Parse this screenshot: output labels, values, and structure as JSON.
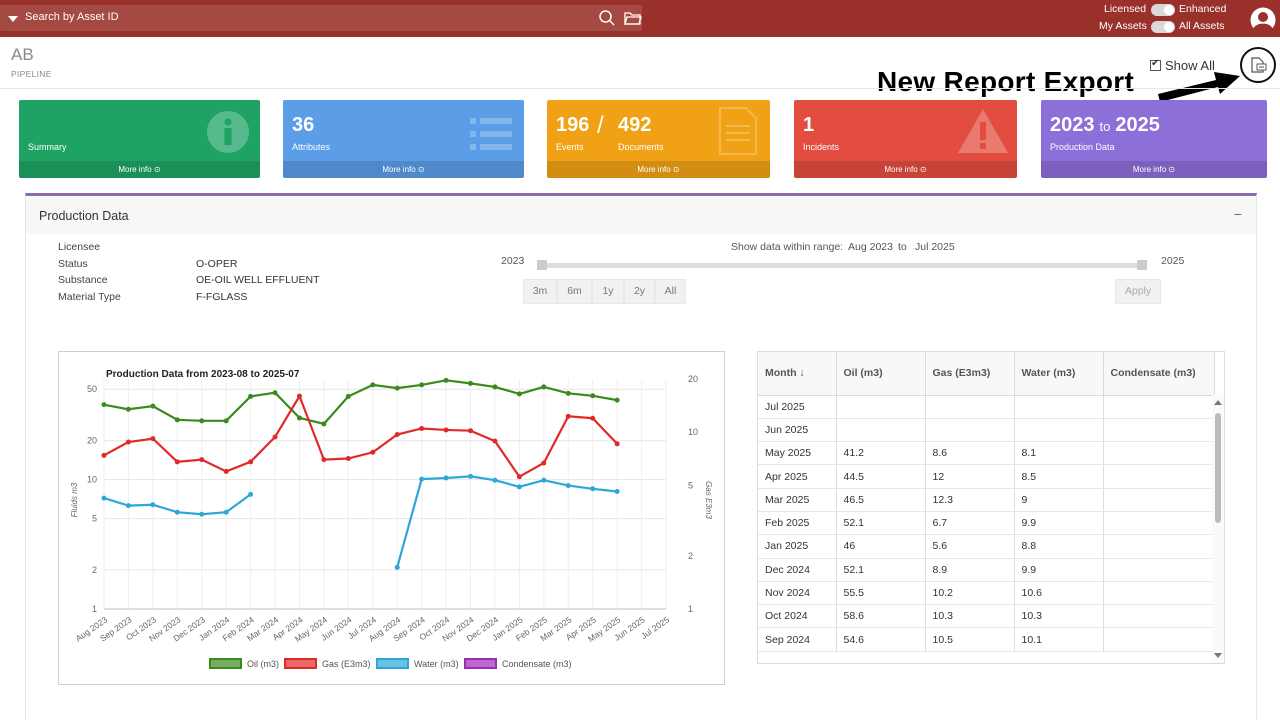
{
  "topbar": {
    "search_label": "Search by Asset ID",
    "licensed_label": "Licensed",
    "enhanced_label": "Enhanced",
    "my_assets_label": "My Assets",
    "all_assets_label": "All Assets"
  },
  "asset": {
    "id": "AB",
    "type": "PIPELINE"
  },
  "show_all_label": "Show All",
  "annotation": "New Report Export",
  "boxes": [
    {
      "number": "",
      "label": "Summary",
      "more": "More info",
      "color": "#1fa365",
      "icon": "info-icon"
    },
    {
      "number": "36",
      "label": "Attributes",
      "more": "More info",
      "color": "#5b9de6",
      "icon": "list-icon"
    },
    {
      "number": "196",
      "number2": "492",
      "label": "Events",
      "label2": "Documents",
      "more": "More info",
      "color": "#f1a116",
      "icon": "document-icon"
    },
    {
      "number": "1",
      "label": "Incidents",
      "more": "More info",
      "color": "#e24d3f",
      "icon": "warning-icon"
    },
    {
      "number": "2023",
      "to": "to",
      "number2": "2025",
      "label": "Production Data",
      "more": "More info",
      "color": "#8c6fd8",
      "icon": ""
    }
  ],
  "panel": {
    "title": "Production Data",
    "meta": [
      {
        "label": "Licensee",
        "value": ""
      },
      {
        "label": "Status",
        "value": "O-OPER"
      },
      {
        "label": "Substance",
        "value": "OE-OIL WELL EFFLUENT"
      },
      {
        "label": "Material Type",
        "value": "F-FGLASS"
      }
    ],
    "range_label": "Show data within range:",
    "range_from": "Aug 2023",
    "range_to_word": "to",
    "range_to": "Jul 2025",
    "year_start": "2023",
    "year_end": "2025",
    "buttons": [
      "3m",
      "6m",
      "1y",
      "2y",
      "All"
    ],
    "apply_label": "Apply"
  },
  "chart_data": {
    "type": "line",
    "title": "Production Data from 2023-08 to 2025-07",
    "ylabel": "Fluids m3",
    "y2label": "Gas E3m3",
    "y_scale": "log",
    "ylim": [
      1,
      60
    ],
    "y2lim": [
      1,
      20
    ],
    "yticks": [
      "1",
      "2",
      "5",
      "10",
      "20",
      "50"
    ],
    "y2ticks": [
      "1",
      "2",
      "5",
      "10",
      "20"
    ],
    "categories": [
      "Aug 2023",
      "Sep 2023",
      "Oct 2023",
      "Nov 2023",
      "Dec 2023",
      "Jan 2024",
      "Feb 2024",
      "Mar 2024",
      "Apr 2024",
      "May 2024",
      "Jun 2024",
      "Jul 2024",
      "Aug 2024",
      "Sep 2024",
      "Oct 2024",
      "Nov 2024",
      "Dec 2024",
      "Jan 2025",
      "Feb 2025",
      "Mar 2025",
      "Apr 2025",
      "May 2025",
      "Jun 2025",
      "Jul 2025"
    ],
    "series": [
      {
        "name": "Oil (m3)",
        "axis": "left",
        "color": "#3a8a1e",
        "values": [
          38,
          35,
          37,
          29,
          28.5,
          28.5,
          44,
          47,
          30,
          27,
          44,
          54,
          51,
          54,
          58.6,
          55.5,
          52.1,
          46,
          52.1,
          46.5,
          44.5,
          41.2,
          null,
          null
        ]
      },
      {
        "name": "Gas (E3m3)",
        "axis": "right",
        "color": "#e02a2a",
        "values": [
          7.4,
          8.8,
          9.2,
          6.8,
          7.0,
          6.0,
          6.8,
          9.4,
          16,
          7.0,
          7.1,
          7.7,
          9.7,
          10.5,
          10.3,
          10.2,
          8.9,
          5.6,
          6.7,
          12.3,
          12,
          8.6,
          null,
          null
        ]
      },
      {
        "name": "Water (m3)",
        "axis": "left",
        "color": "#2ca7d8",
        "values": [
          7.2,
          6.3,
          6.4,
          5.6,
          5.4,
          5.6,
          7.7,
          null,
          null,
          null,
          null,
          null,
          2.1,
          10.1,
          10.3,
          10.6,
          9.9,
          8.8,
          9.9,
          9,
          8.5,
          8.1,
          null,
          null
        ]
      },
      {
        "name": "Condensate (m3)",
        "axis": "left",
        "color": "#9c2bb5",
        "values": []
      }
    ]
  },
  "table": {
    "headers": [
      "Month",
      "Oil (m3)",
      "Gas (E3m3)",
      "Water (m3)",
      "Condensate (m3)"
    ],
    "rows": [
      [
        "Jul 2025",
        "",
        "",
        "",
        ""
      ],
      [
        "Jun 2025",
        "",
        "",
        "",
        ""
      ],
      [
        "May 2025",
        "41.2",
        "8.6",
        "8.1",
        ""
      ],
      [
        "Apr 2025",
        "44.5",
        "12",
        "8.5",
        ""
      ],
      [
        "Mar 2025",
        "46.5",
        "12.3",
        "9",
        ""
      ],
      [
        "Feb 2025",
        "52.1",
        "6.7",
        "9.9",
        ""
      ],
      [
        "Jan 2025",
        "46",
        "5.6",
        "8.8",
        ""
      ],
      [
        "Dec 2024",
        "52.1",
        "8.9",
        "9.9",
        ""
      ],
      [
        "Nov 2024",
        "55.5",
        "10.2",
        "10.6",
        ""
      ],
      [
        "Oct 2024",
        "58.6",
        "10.3",
        "10.3",
        ""
      ],
      [
        "Sep 2024",
        "54.6",
        "10.5",
        "10.1",
        ""
      ]
    ]
  }
}
